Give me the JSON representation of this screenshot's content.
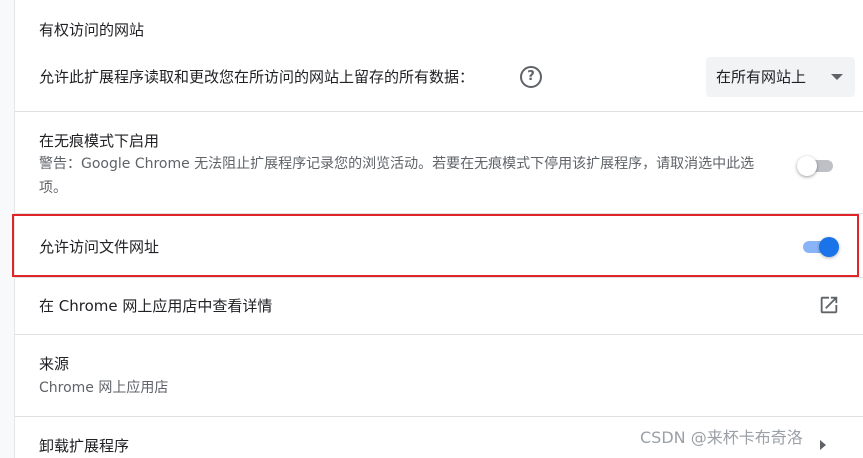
{
  "site_access": {
    "title": "有权访问的网站",
    "description": "允许此扩展程序读取和更改您在所访问的网站上留存的所有数据：",
    "help_icon": "help-circle-icon",
    "select_value": "在所有网站上"
  },
  "incognito": {
    "title": "在无痕模式下启用",
    "warning": "警告：Google Chrome 无法阻止扩展程序记录您的浏览活动。若要在无痕模式下停用该扩展程序，请取消选中此选项。",
    "enabled": false
  },
  "file_urls": {
    "label": "允许访问文件网址",
    "enabled": true
  },
  "webstore": {
    "label": "在 Chrome 网上应用店中查看详情",
    "icon": "open-in-new-icon"
  },
  "source": {
    "title": "来源",
    "value": "Chrome 网上应用店"
  },
  "uninstall": {
    "label": "卸载扩展程序"
  },
  "watermark": "CSDN @来杯卡布奇洛",
  "colors": {
    "accent": "#1a73e8",
    "accent_track": "#8ab4f8",
    "highlight": "#e0242a"
  }
}
